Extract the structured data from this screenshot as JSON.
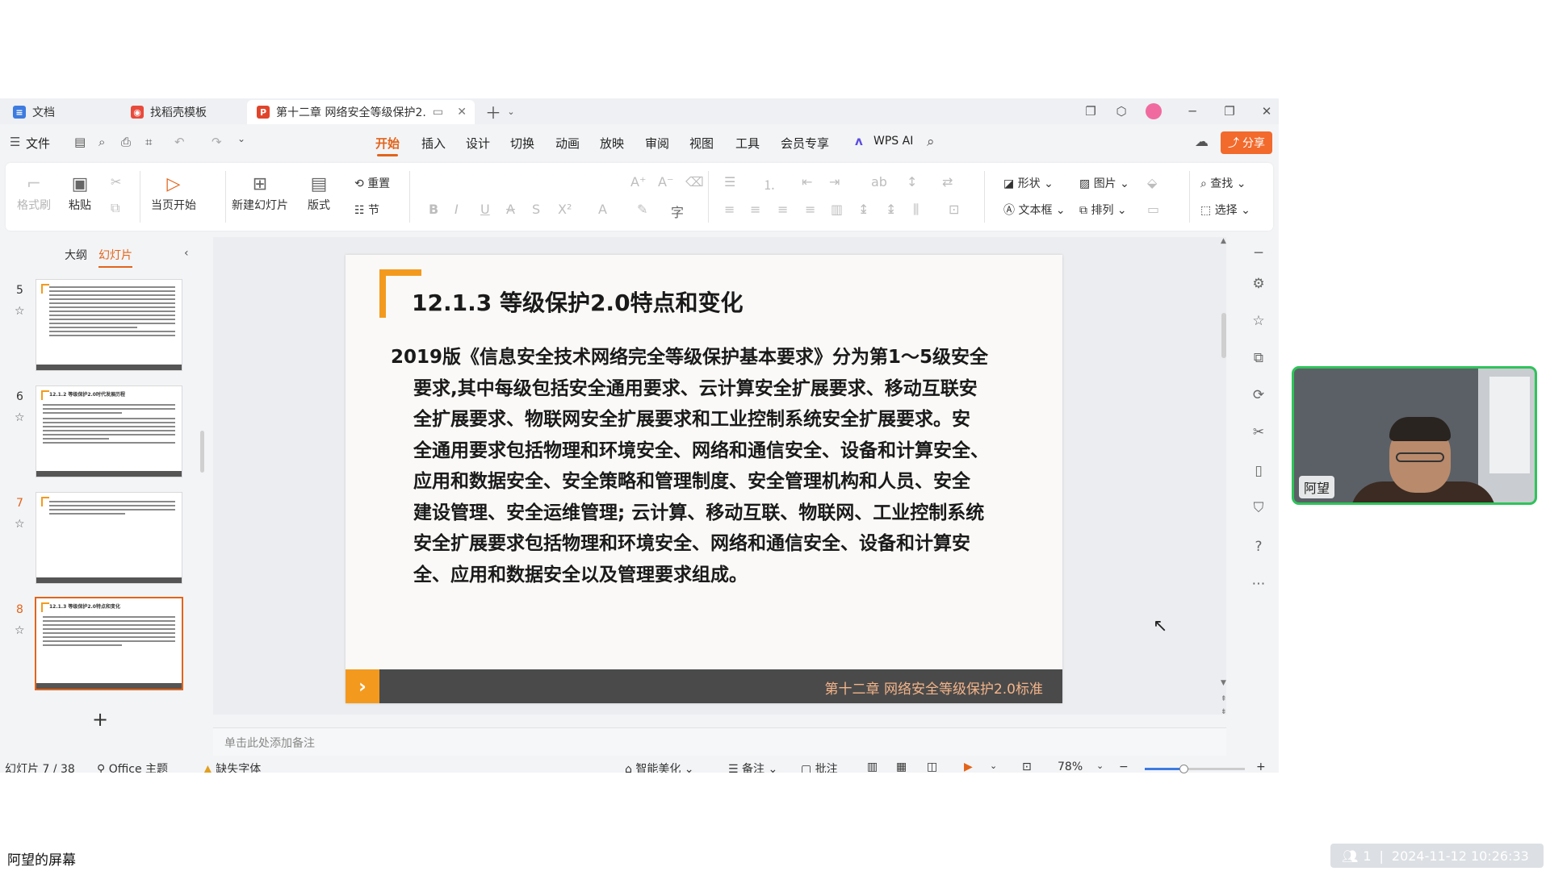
{
  "tabs": [
    {
      "label": "文档",
      "icon": "doc-icon"
    },
    {
      "label": "找稻壳模板",
      "icon": "docer-icon"
    },
    {
      "label": "第十二章 网络安全等级保护2.",
      "icon": "ppt-icon"
    }
  ],
  "menu": {
    "file": "文件",
    "items": [
      "开始",
      "插入",
      "设计",
      "切换",
      "动画",
      "放映",
      "审阅",
      "视图",
      "工具",
      "会员专享"
    ],
    "active": "开始",
    "wps_ai": "WPS AI",
    "share": "分享"
  },
  "ribbon": {
    "format_painter": "格式刷",
    "paste": "粘贴",
    "start_from_current": "当页开始",
    "new_slide": "新建幻灯片",
    "layout": "版式",
    "reset": "重置",
    "section": "节",
    "shape": "形状",
    "picture": "图片",
    "textbox": "文本框",
    "arrange": "排列",
    "find": "查找",
    "select": "选择"
  },
  "left_panel": {
    "tab_outline": "大纲",
    "tab_slides": "幻灯片",
    "thumbs": [
      {
        "num": "5",
        "title": ""
      },
      {
        "num": "6",
        "title": "12.1.2 等级保护2.0时代发展历程"
      },
      {
        "num": "7",
        "title": ""
      },
      {
        "num": "8",
        "title": "12.1.3 等级保护2.0特点和变化"
      }
    ]
  },
  "slide": {
    "title": "12.1.3 等级保护2.0特点和变化",
    "body_lines": [
      "2019版《信息安全技术网络完全等级保护基本要求》分为第1～5级安全",
      "要求,其中每级包括安全通用要求、云计算安全扩展要求、移动互联安",
      "全扩展要求、物联网安全扩展要求和工业控制系统安全扩展要求。安",
      "全通用要求包括物理和环境安全、网络和通信安全、设备和计算安全、",
      "应用和数据安全、安全策略和管理制度、安全管理机构和人员、安全",
      "建设管理、安全运维管理; 云计算、移动互联、物联网、工业控制系统",
      "安全扩展要求包括物理和环境安全、网络和通信安全、设备和计算安",
      "全、应用和数据安全以及管理要求组成。"
    ],
    "footer": "第十二章  网络安全等级保护2.0标准"
  },
  "notes_placeholder": "单击此处添加备注",
  "status": {
    "slide_count": "幻灯片 7 / 38",
    "theme": "Office 主题",
    "missing_font": "缺失字体",
    "beautify": "智能美化",
    "notes": "备注",
    "comments": "批注",
    "zoom": "78%"
  },
  "video": {
    "name": "阿望"
  },
  "caption": "阿望的屏幕",
  "meeting": {
    "participants": "1",
    "datetime": "2024-11-12 10:26:33"
  },
  "colors": {
    "accent": "#e2641b",
    "slide_orange": "#f39a1e",
    "speaker_border": "#2ec35a"
  }
}
